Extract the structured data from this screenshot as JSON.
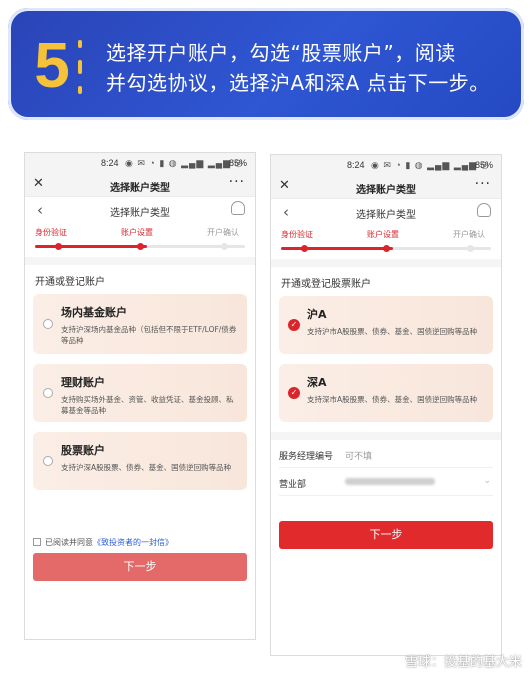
{
  "banner": {
    "step_number": "5",
    "line1": "选择开户账户，勾选“股票账户”，阅读",
    "line2": "并勾选协议，选择沪A和深A 点击下一步。"
  },
  "left_phone": {
    "status": {
      "time": "8:24",
      "battery": "85%"
    },
    "appbar": {
      "close": "✕",
      "title": "选择账户类型",
      "more": "···"
    },
    "navbar": {
      "back": "‹",
      "title": "选择账户类型"
    },
    "steps": [
      "身份验证",
      "账户设置",
      "开户确认"
    ],
    "section_title": "开通或登记账户",
    "cards": [
      {
        "name": "场内基金账户",
        "desc": "支持沪深场内基金品种（包括但不限于ETF/LOF/债券等品种"
      },
      {
        "name": "理财账户",
        "desc": "支持购买场外基金、资管、收益凭证、基金投顾、私募基金等品种"
      },
      {
        "name": "股票账户",
        "desc": "支持沪深A股股票、债券、基金、国债逆回购等品种"
      }
    ],
    "agree": {
      "prefix": "已阅读并同意",
      "link": "《致投资者的一封信》"
    },
    "next_button": "下一步"
  },
  "right_phone": {
    "status": {
      "time": "8:24",
      "battery": "85%"
    },
    "appbar": {
      "close": "✕",
      "title": "选择账户类型",
      "more": "···"
    },
    "navbar": {
      "back": "‹",
      "title": "选择账户类型"
    },
    "steps": [
      "身份验证",
      "账户设置",
      "开户确认"
    ],
    "section_title": "开通或登记股票账户",
    "cards": [
      {
        "name": "沪A",
        "desc": "支持沪市A股股票、债券、基金、国债逆回购等品种"
      },
      {
        "name": "深A",
        "desc": "支持深市A股股票、债券、基金、国债逆回购等品种"
      }
    ],
    "manager": {
      "label": "服务经理编号",
      "value": "可不填"
    },
    "branch": {
      "label": "营业部"
    },
    "next_button": "下一步"
  },
  "watermark": "雪球：投基的基大米",
  "colors": {
    "accent": "#d9262c",
    "banner_bg": "#2f56d3",
    "banner_number": "#f6c23a"
  }
}
